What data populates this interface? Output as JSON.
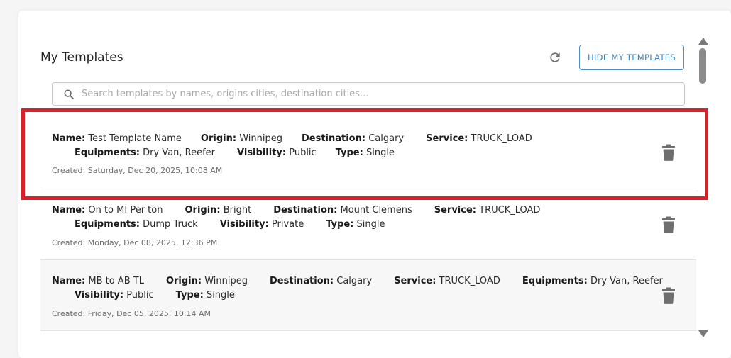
{
  "header": {
    "title": "My Templates",
    "hide_button_label": "HIDE MY TEMPLATES",
    "refresh_icon": "refresh-icon"
  },
  "search": {
    "placeholder": "Search templates by names, origins cities, destination cities...",
    "value": ""
  },
  "labels": {
    "name": "Name:",
    "origin": "Origin:",
    "destination": "Destination:",
    "service": "Service:",
    "equipments": "Equipments:",
    "visibility": "Visibility:",
    "type": "Type:"
  },
  "templates": [
    {
      "name": "Test Template Name",
      "origin": "Winnipeg",
      "destination": "Calgary",
      "service": "TRUCK_LOAD",
      "equipments": "Dry Van, Reefer",
      "visibility": "Public",
      "type": "Single",
      "created": "Created: Saturday, Dec 20, 2025, 10:08 AM"
    },
    {
      "name": "On to MI Per ton",
      "origin": "Bright",
      "destination": "Mount Clemens",
      "service": "TRUCK_LOAD",
      "equipments": "Dump Truck",
      "visibility": "Private",
      "type": "Single",
      "created": "Created: Monday, Dec 08, 2025, 12:36 PM"
    },
    {
      "name": "MB to AB TL",
      "origin": "Winnipeg",
      "destination": "Calgary",
      "service": "TRUCK_LOAD",
      "equipments": "Dry Van, Reefer",
      "visibility": "Public",
      "type": "Single",
      "created": "Created: Friday, Dec 05, 2025, 10:14 AM"
    }
  ],
  "colors": {
    "accent": "#3f7fb6",
    "highlight": "#d9212a",
    "icon": "#6e6e6e"
  }
}
